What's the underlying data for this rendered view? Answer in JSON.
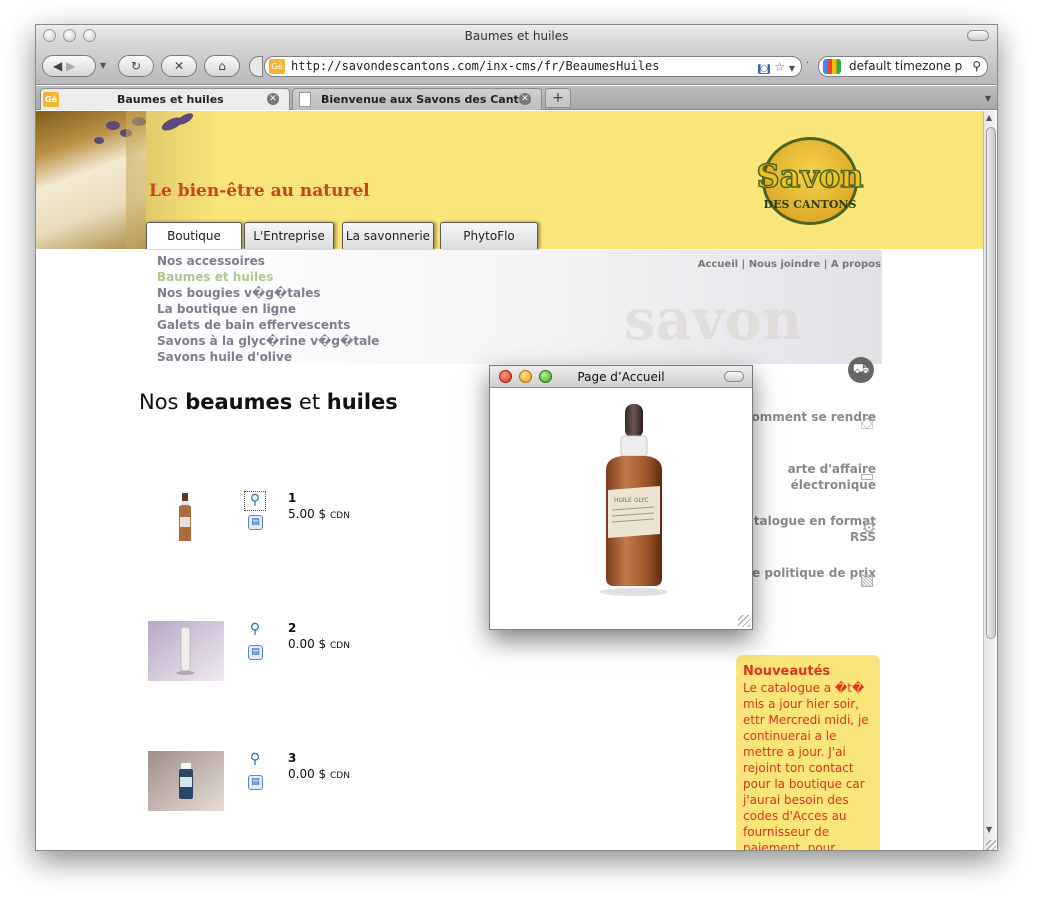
{
  "window": {
    "title": "Baumes et huiles"
  },
  "toolbar": {
    "back_icon": "back-arrow-icon",
    "forward_icon": "forward-arrow-icon",
    "reload_icon": "reload-icon",
    "stop_icon": "stop-icon",
    "home_icon": "home-icon",
    "url": "http://savondescantons.com/inx-cms/fr/BeaumesHuiles",
    "search_value": "default timezone p"
  },
  "tabs": [
    {
      "label": "Baumes et huiles",
      "active": true
    },
    {
      "label": "Bienvenue aux Savons des Cant...",
      "active": false
    }
  ],
  "site": {
    "tagline": "Le bien-être au naturel",
    "logo_word": "Savon",
    "logo_sub": "DES CANTONS",
    "nav": [
      "Boutique",
      "L'Entreprise",
      "La savonnerie",
      "PhytoFlo"
    ],
    "subnav": [
      "Nos accessoires",
      "Baumes et huiles",
      "Nos bougies v�g�tales",
      "La boutique en ligne",
      "Galets de bain effervescents",
      "Savons à la glyc�rine v�g�tale",
      "Savons huile d'olive"
    ],
    "toplinks": {
      "home": "Accueil",
      "contact": "Nous joindre",
      "about": "A propos",
      "sep": "|"
    },
    "watermark": "savon"
  },
  "main": {
    "heading_pre": "Nos",
    "heading_b1": "beaumes",
    "heading_mid": "et",
    "heading_b2": "huiles",
    "products": [
      {
        "num": "1",
        "price": "5.00 $",
        "currency": "CDN"
      },
      {
        "num": "2",
        "price": "0.00 $",
        "currency": "CDN"
      },
      {
        "num": "3",
        "price": "0.00 $",
        "currency": "CDN"
      }
    ]
  },
  "sidebar": {
    "links": [
      {
        "label": "Comment se rendre",
        "icon": "directions-icon"
      },
      {
        "label": "arte d'affaire électronique",
        "icon": "business-card-icon"
      },
      {
        "label": "catalogue en format RSS",
        "icon": "rss-gear-icon"
      },
      {
        "label": "e politique de prix",
        "icon": "price-policy-icon"
      }
    ],
    "news_title": "Nouveautés",
    "news_body": "Le catalogue a �t� mis a jour hier soir, ettr Mercredi midi, je continuerai a le mettre a jour. J'ai rejoint ton contact pour la boutique car j'aurai besoin des codes d'Acces au fournisseur de paiement, pour"
  },
  "popup": {
    "title": "Page d’Accueil"
  },
  "colors": {
    "banner": "#fae57a",
    "tagline": "#d2401e",
    "news_text": "#e0351c",
    "subnav_active": "#aec78c"
  }
}
